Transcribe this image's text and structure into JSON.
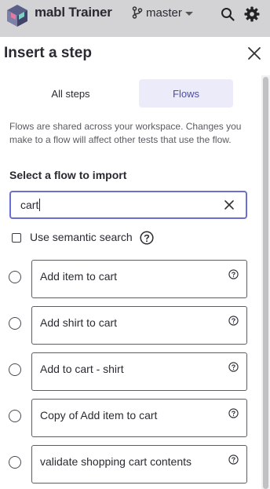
{
  "app": {
    "title": "mabl Trainer",
    "branch": "master"
  },
  "topbar": {
    "icons": [
      "mabl-logo-icon",
      "git-branch-icon",
      "chevron-down-icon",
      "search-icon",
      "gear-icon"
    ]
  },
  "panel": {
    "title": "Insert a step",
    "close_icon": "close-icon"
  },
  "tabs": [
    {
      "label": "All steps",
      "active": false
    },
    {
      "label": "Flows",
      "active": true
    }
  ],
  "description": "Flows are shared across your workspace. Changes you make to a flow will affect other tests that use the flow.",
  "select_label": "Select a flow to import",
  "search": {
    "value": "cart",
    "clear_icon": "clear-icon"
  },
  "semantic_search": {
    "label": "Use semantic search",
    "checked": false
  },
  "flows": [
    {
      "name": "Add item to cart"
    },
    {
      "name": "Add shirt to cart"
    },
    {
      "name": "Add to cart - shirt"
    },
    {
      "name": "Copy of Add item to cart"
    },
    {
      "name": "validate shopping cart contents"
    }
  ],
  "colors": {
    "accent": "#6b6ed1",
    "tab_active_bg": "#ebebfa",
    "topbar_bg": "#d3d3d6"
  }
}
